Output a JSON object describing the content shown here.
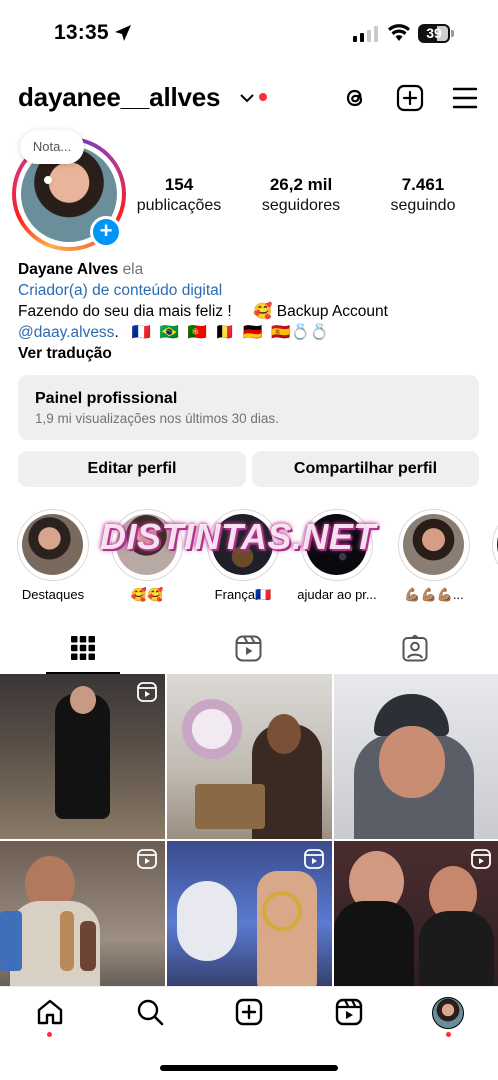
{
  "status_bar": {
    "time": "13:35",
    "battery": "39"
  },
  "header": {
    "username": "dayanee__allves",
    "icons": [
      "threads-icon",
      "create-plus-icon",
      "menu-icon"
    ]
  },
  "profile": {
    "note_label": "Nota...",
    "stats": [
      {
        "number": "154",
        "label": "publicações"
      },
      {
        "number": "26,2 mil",
        "label": "seguidores"
      },
      {
        "number": "7.461",
        "label": "seguindo"
      }
    ],
    "name": "Dayane Alves",
    "pronoun": "ela",
    "category": "Criador(a) de conteúdo digital",
    "bio_line1": "Fazendo do seu dia mais feliz !     🥰 Backup Account",
    "bio_handle": "@daay.alvess",
    "bio_flags": ".   🇫🇷  🇧🇷  🇵🇹  🇧🇪  🇩🇪  🇪🇸💍💍",
    "see_translation": "Ver tradução"
  },
  "professional_panel": {
    "title": "Painel profissional",
    "subtitle": "1,9 mi visualizações nos últimos 30 dias."
  },
  "buttons": {
    "edit_profile": "Editar perfil",
    "share_profile": "Compartilhar perfil"
  },
  "highlights": [
    {
      "label": "Destaques"
    },
    {
      "label": "🥰🥰"
    },
    {
      "label": "França🇫🇷"
    },
    {
      "label": "ajudar ao pr..."
    },
    {
      "label": "💪🏽💪🏽💪🏽..."
    }
  ],
  "watermark": "DISTINTAS.NET",
  "tabs": [
    "grid-icon",
    "reels-icon",
    "tagged-icon"
  ],
  "bottom_nav": [
    "home-icon",
    "search-icon",
    "create-icon",
    "reels-icon",
    "profile-avatar"
  ],
  "colors": {
    "accent_blue": "#0095f6",
    "notification_red": "#ff2d3a",
    "link_blue": "#2a6cb0",
    "button_gray": "#efefef"
  }
}
